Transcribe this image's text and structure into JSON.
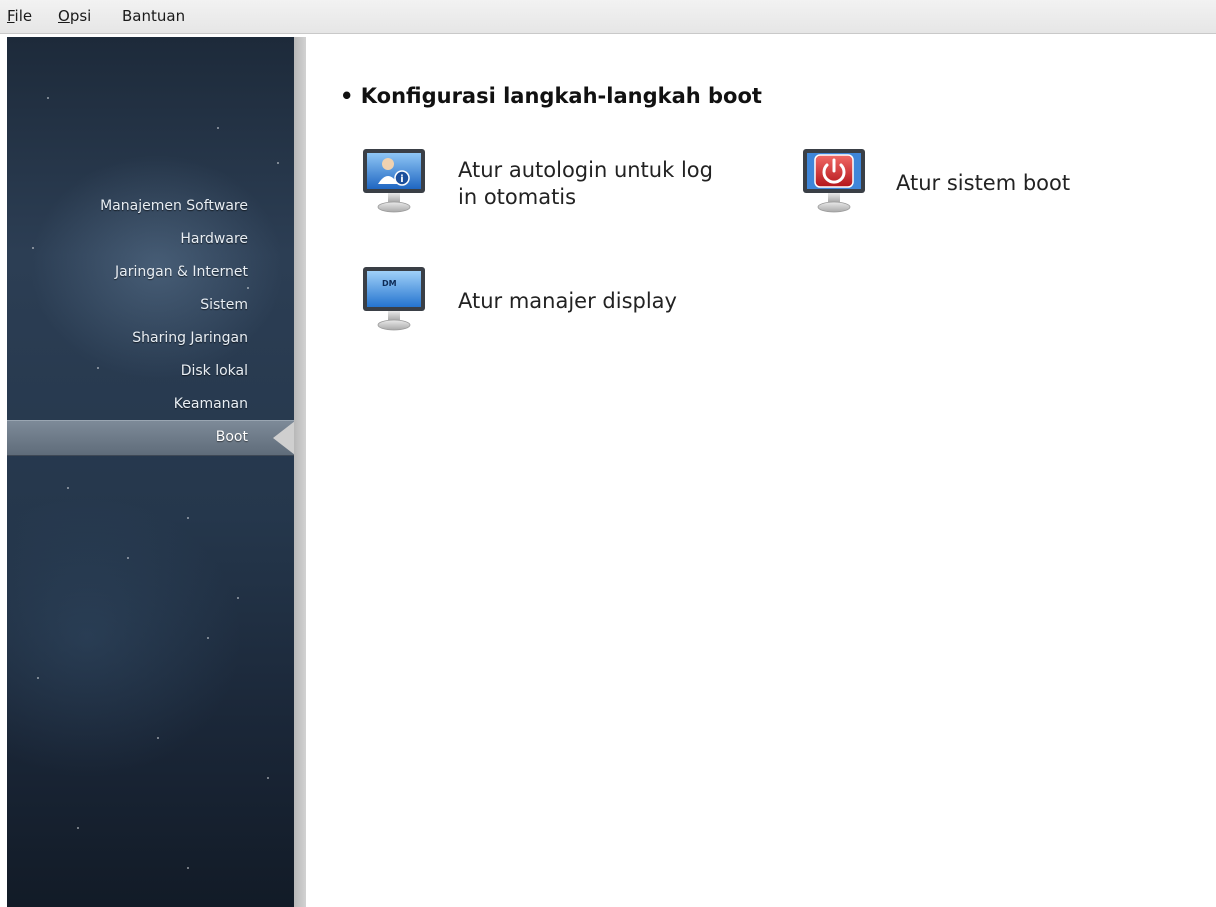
{
  "menu": {
    "file": {
      "accel": "F",
      "rest": "ile"
    },
    "opsi": {
      "accel": "O",
      "rest": "psi"
    },
    "bantuan": "Bantuan"
  },
  "sidebar": {
    "items": [
      {
        "label": "Manajemen Software"
      },
      {
        "label": "Hardware"
      },
      {
        "label": "Jaringan & Internet"
      },
      {
        "label": "Sistem"
      },
      {
        "label": "Sharing Jaringan"
      },
      {
        "label": "Disk lokal"
      },
      {
        "label": "Keamanan"
      }
    ],
    "selected": {
      "label": "Boot"
    }
  },
  "main": {
    "section_title": "• Konfigurasi langkah-langkah boot",
    "tools": [
      {
        "line1": "Atur autologin untuk log",
        "line2": "in otomatis",
        "icon": "user-info-monitor-icon"
      },
      {
        "line1": "Atur sistem boot",
        "icon": "power-monitor-icon"
      },
      {
        "line1": "Atur manajer display",
        "icon_text": "DM",
        "icon": "dm-monitor-icon"
      }
    ]
  },
  "colors": {
    "sidebar_bg": "#25374c",
    "selected_bg": "#6e7b89",
    "power_red": "#d8262b",
    "screen_blue": "#2f7fd6"
  }
}
